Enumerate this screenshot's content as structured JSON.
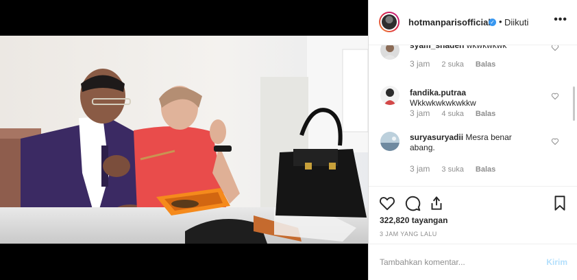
{
  "post": {
    "username": "hotmanparisofficial",
    "verified_mark": "✓",
    "separator": "•",
    "follow_status": "Diikuti",
    "more_label": "•••"
  },
  "comments": [
    {
      "username": "syam_shaden",
      "text": "wkwkwkwk",
      "time": "3 jam",
      "likes": "2 suka",
      "reply": "Balas"
    },
    {
      "username": "fandika.putraa",
      "text": "Wkkwkwkwkwkkw",
      "time": "3 jam",
      "likes": "4 suka",
      "reply": "Balas"
    },
    {
      "username": "suryasuryadii",
      "text": "Mesra benar abang.",
      "time": "3 jam",
      "likes": "3 suka",
      "reply": "Balas"
    }
  ],
  "stats": {
    "views": "322,820 tayangan",
    "time_ago": "3 JAM YANG LALU"
  },
  "composer": {
    "placeholder": "Tambahkan komentar...",
    "send_label": "Kirim"
  },
  "icons": {
    "like": "heart-icon",
    "comment": "comment-icon",
    "share": "share-icon",
    "save": "bookmark-icon",
    "more": "more-icon",
    "verified": "verified-icon"
  },
  "colors": {
    "verified_blue": "#3897f0",
    "send_disabled": "#b2dffc",
    "muted_text": "#8e8e8e"
  }
}
